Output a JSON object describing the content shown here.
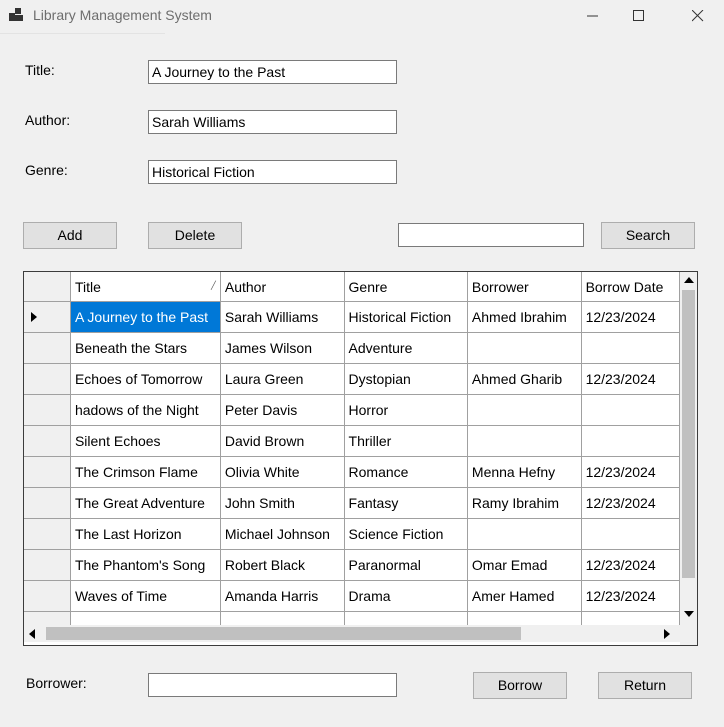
{
  "window": {
    "title": "Library Management System",
    "app_icon": "app-window-icon",
    "controls": [
      "minimize-icon",
      "maximize-icon",
      "close-icon"
    ]
  },
  "form": {
    "title_label": "Title:",
    "title_value": "A Journey to the Past",
    "author_label": "Author:",
    "author_value": "Sarah Williams",
    "genre_label": "Genre:",
    "genre_value": "Historical Fiction",
    "borrower_label": "Borrower:",
    "borrower_value": "",
    "search_value": ""
  },
  "buttons": {
    "add": "Add",
    "delete": "Delete",
    "search": "Search",
    "borrow": "Borrow",
    "return": "Return"
  },
  "grid": {
    "columns": [
      "Title",
      "Author",
      "Genre",
      "Borrower",
      "Borrow Date"
    ],
    "sorted_column": "Title",
    "selected_row": 0,
    "rows": [
      [
        "A Journey to the Past",
        "Sarah Williams",
        "Historical Fiction",
        "Ahmed Ibrahim",
        "12/23/2024"
      ],
      [
        "Beneath the Stars",
        "James Wilson",
        "Adventure",
        "",
        ""
      ],
      [
        "Echoes of Tomorrow",
        "Laura Green",
        "Dystopian",
        "Ahmed Gharib",
        "12/23/2024"
      ],
      [
        "hadows of the Night",
        "Peter Davis",
        "Horror",
        "",
        ""
      ],
      [
        "Silent Echoes",
        "David Brown",
        "Thriller",
        "",
        ""
      ],
      [
        "The Crimson Flame",
        "Olivia White",
        "Romance",
        "Menna Hefny",
        "12/23/2024"
      ],
      [
        "The Great Adventure",
        "John Smith",
        "Fantasy",
        "Ramy Ibrahim",
        "12/23/2024"
      ],
      [
        "The Last Horizon",
        "Michael Johnson",
        "Science Fiction",
        "",
        ""
      ],
      [
        "The Phantom's Song",
        "Robert Black",
        "Paranormal",
        "Omar Emad",
        "12/23/2024"
      ],
      [
        "Waves of Time",
        "Amanda Harris",
        "Drama",
        "Amer Hamed",
        "12/23/2024"
      ]
    ]
  },
  "colors": {
    "selection": "#0078d7",
    "background": "#f0f0f0"
  }
}
